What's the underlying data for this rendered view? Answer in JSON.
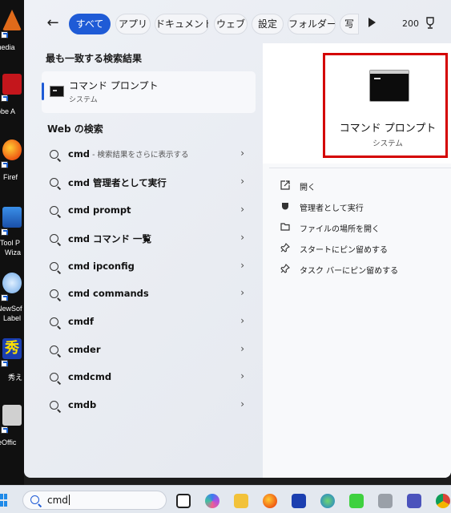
{
  "desktop": {
    "icons": [
      {
        "label": "media",
        "color": "#e06a1a"
      },
      {
        "label": "obe A",
        "color": "#c4161c"
      },
      {
        "label": "Firef",
        "color": "#ef7a14"
      },
      {
        "label": "iTool P",
        "label2": "Wiza",
        "color": "#2b7de0"
      },
      {
        "label": "NewSof",
        "label2": "Label",
        "color": "#6fa9e8"
      },
      {
        "label": "秀え",
        "color": "#1b3fb0"
      },
      {
        "label": "reOffic",
        "color": "#d0d0d0"
      }
    ]
  },
  "filterbar": {
    "back": "←",
    "filters": [
      "すべて",
      "アプリ",
      "ドキュメント",
      "ウェブ",
      "設定",
      "フォルダー",
      "写"
    ],
    "active_filter": "すべて",
    "count": "200"
  },
  "best_match": {
    "heading": "最も一致する検索結果",
    "title": "コマンド プロンプト",
    "subtitle": "システム"
  },
  "web_search": {
    "heading": "Web の検索",
    "results": [
      {
        "query": "cmd",
        "suffix": " - 検索結果をさらに表示する"
      },
      {
        "query": "cmd 管理者として実行",
        "suffix": ""
      },
      {
        "query": "cmd prompt",
        "suffix": ""
      },
      {
        "query": "cmd コマンド 一覧",
        "suffix": ""
      },
      {
        "query": "cmd ipconfig",
        "suffix": ""
      },
      {
        "query": "cmd commands",
        "suffix": ""
      },
      {
        "query": "cmdf",
        "suffix": ""
      },
      {
        "query": "cmder",
        "suffix": ""
      },
      {
        "query": "cmdcmd",
        "suffix": ""
      },
      {
        "query": "cmdb",
        "suffix": ""
      }
    ]
  },
  "detail": {
    "title": "コマンド プロンプト",
    "subtitle": "システム",
    "actions": [
      {
        "label": "開く",
        "icon": "open-icon"
      },
      {
        "label": "管理者として実行",
        "icon": "shield-icon"
      },
      {
        "label": "ファイルの場所を開く",
        "icon": "folder-icon"
      },
      {
        "label": "スタートにピン留めする",
        "icon": "pin-icon"
      },
      {
        "label": "タスク バーにピン留めする",
        "icon": "pin-icon"
      }
    ],
    "highlight_color": "#d40000"
  },
  "taskbar": {
    "search_value": "cmd",
    "apps": [
      "task-view",
      "copilot",
      "file-explorer",
      "firefox",
      "hidemaru",
      "chrome-like",
      "ledger",
      "photo",
      "teams",
      "chrome"
    ]
  }
}
